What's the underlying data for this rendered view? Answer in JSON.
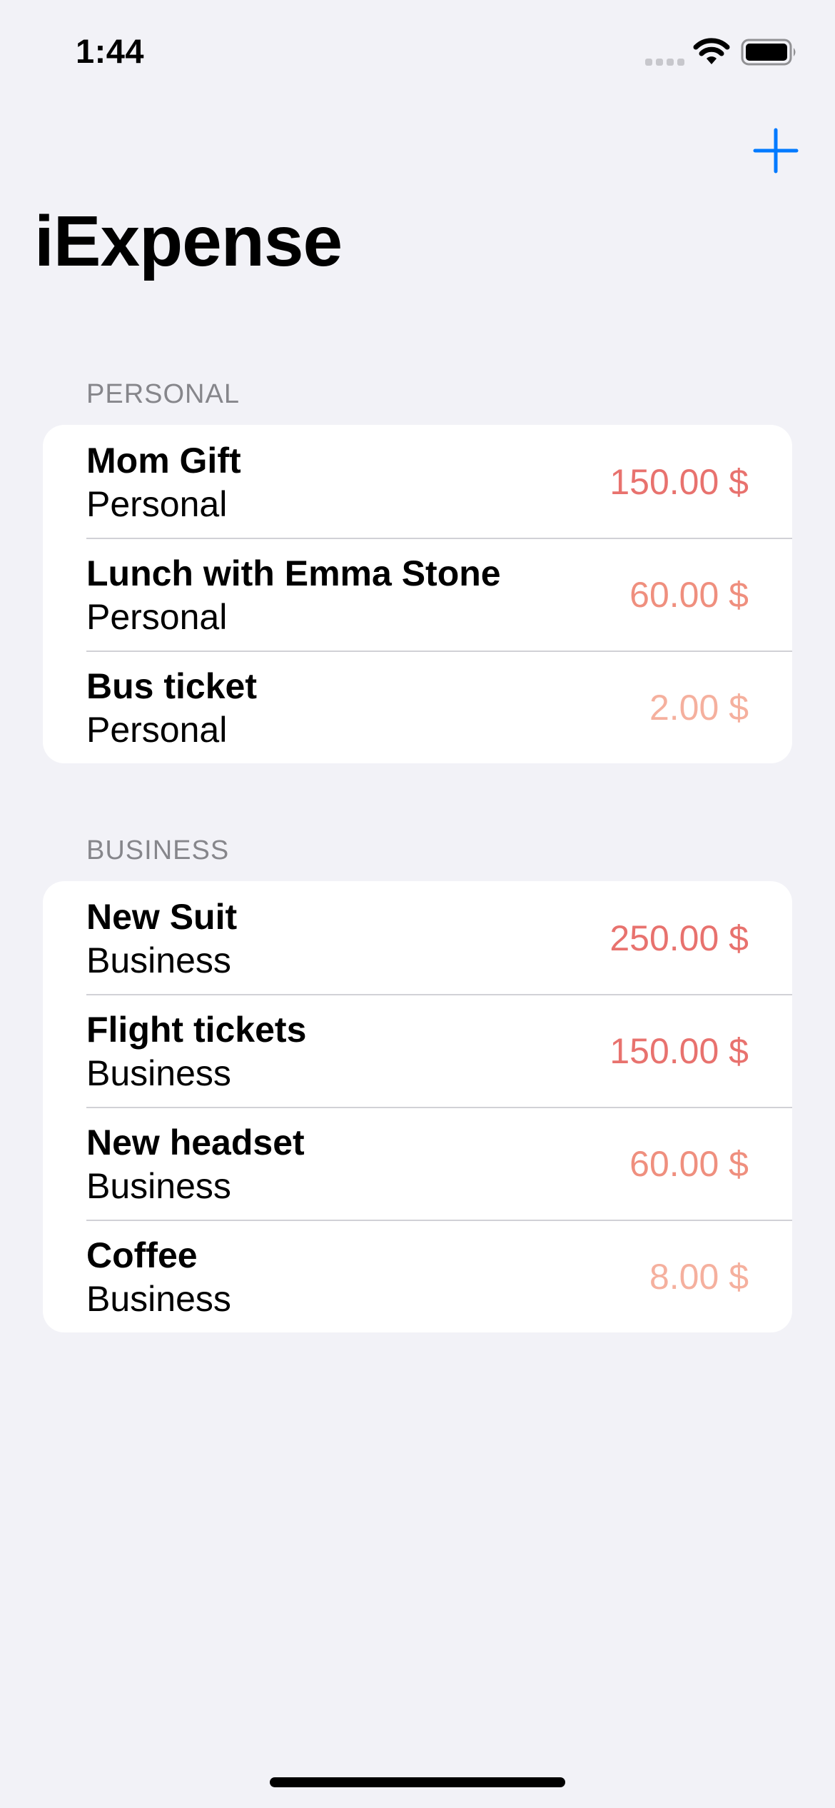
{
  "status_bar": {
    "time": "1:44",
    "icons": [
      "cellular-signal-icon",
      "wifi-icon",
      "battery-icon"
    ]
  },
  "nav": {
    "title": "iExpense",
    "add_icon": "plus-icon",
    "accent_color": "#007AFF"
  },
  "sections": [
    {
      "header": "PERSONAL",
      "items": [
        {
          "name": "Mom Gift",
          "type": "Personal",
          "amount": "150.00 $",
          "color": "#E8726E"
        },
        {
          "name": "Lunch with Emma Stone",
          "type": "Personal",
          "amount": "60.00 $",
          "color": "#EF8F7E"
        },
        {
          "name": "Bus ticket",
          "type": "Personal",
          "amount": "2.00 $",
          "color": "#F5B09E"
        }
      ]
    },
    {
      "header": "BUSINESS",
      "items": [
        {
          "name": "New Suit",
          "type": "Business",
          "amount": "250.00 $",
          "color": "#E8726E"
        },
        {
          "name": "Flight tickets",
          "type": "Business",
          "amount": "150.00 $",
          "color": "#E8726E"
        },
        {
          "name": "New headset",
          "type": "Business",
          "amount": "60.00 $",
          "color": "#EF8F7E"
        },
        {
          "name": "Coffee",
          "type": "Business",
          "amount": "8.00 $",
          "color": "#F5B09E"
        }
      ]
    }
  ]
}
